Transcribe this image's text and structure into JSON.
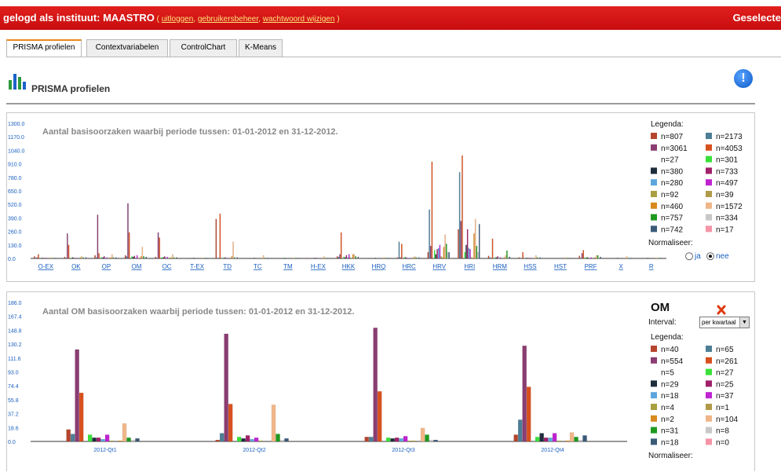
{
  "topbar": {
    "prefix": "gelogd als instituut: MAASTRO",
    "open_paren": " ( ",
    "link_logout": "uitloggen",
    "comma1": ", ",
    "link_users": "gebruikersbeheer",
    "comma2": ", ",
    "link_password": "wachtwoord wijzigen",
    "close_paren": " )",
    "right_text": "Geselecte",
    "color": "#d3151a"
  },
  "tabs": [
    "PRISMA profielen",
    "Contextvariabelen",
    "ControlChart",
    "K-Means"
  ],
  "header": {
    "title": "PRISMA profielen"
  },
  "chart_data": [
    {
      "type": "bar",
      "title": "Aantal basisoorzaken waarbij periode tussen: 01-01-2012 en 31-12-2012.",
      "categories": [
        "O-EX",
        "OK",
        "OP",
        "OM",
        "OC",
        "T-EX",
        "TD",
        "TC",
        "TM",
        "H-EX",
        "HKK",
        "HRQ",
        "HRC",
        "HRV",
        "HRI",
        "HRM",
        "HSS",
        "HST",
        "PRF",
        "X",
        "R"
      ],
      "yticks": [
        "0.0",
        "130.0",
        "260.0",
        "390.0",
        "520.0",
        "650.0",
        "780.0",
        "910.0",
        "1040.0",
        "1170.0",
        "1300.0"
      ],
      "ylim": [
        0,
        1300
      ],
      "legend_title": "Legenda:",
      "series": [
        {
          "label": "n=807",
          "color": "#b5452e",
          "values": [
            20,
            15,
            30,
            30,
            15,
            0,
            380,
            0,
            0,
            5,
            20,
            0,
            10,
            60,
            280,
            25,
            10,
            0,
            25,
            0,
            0
          ]
        },
        {
          "label": "n=2173",
          "color": "#4e7e95",
          "values": [
            5,
            5,
            10,
            20,
            5,
            0,
            5,
            0,
            0,
            0,
            15,
            5,
            160,
            470,
            830,
            10,
            5,
            0,
            5,
            0,
            0
          ]
        },
        {
          "label": "n=3061",
          "color": "#8a3d72",
          "values": [
            10,
            240,
            420,
            530,
            250,
            0,
            5,
            0,
            0,
            0,
            40,
            0,
            10,
            120,
            360,
            5,
            0,
            0,
            50,
            0,
            0
          ]
        },
        {
          "label": "n=4053",
          "color": "#d8501e",
          "values": [
            40,
            130,
            50,
            250,
            200,
            0,
            430,
            0,
            0,
            0,
            250,
            0,
            140,
            930,
            990,
            190,
            60,
            0,
            80,
            0,
            0
          ]
        },
        {
          "label": "n=27",
          "color": "#ffffff",
          "values": [
            0,
            0,
            0,
            0,
            0,
            0,
            0,
            0,
            0,
            0,
            0,
            0,
            0,
            0,
            0,
            0,
            0,
            0,
            0,
            0,
            0
          ]
        },
        {
          "label": "n=301",
          "color": "#39e039",
          "values": [
            0,
            5,
            10,
            20,
            10,
            0,
            5,
            0,
            5,
            0,
            15,
            0,
            10,
            80,
            60,
            10,
            0,
            0,
            10,
            0,
            0
          ]
        },
        {
          "label": "n=380",
          "color": "#1e2d3c",
          "values": [
            5,
            10,
            10,
            15,
            10,
            5,
            5,
            5,
            5,
            5,
            10,
            5,
            10,
            40,
            130,
            10,
            5,
            0,
            10,
            5,
            5
          ]
        },
        {
          "label": "n=733",
          "color": "#a0206a",
          "values": [
            5,
            5,
            20,
            25,
            20,
            0,
            10,
            0,
            0,
            5,
            30,
            0,
            5,
            90,
            280,
            20,
            5,
            0,
            5,
            0,
            0
          ]
        },
        {
          "label": "n=280",
          "color": "#5ca6dc",
          "values": [
            0,
            0,
            5,
            5,
            5,
            0,
            5,
            0,
            0,
            0,
            10,
            0,
            5,
            100,
            100,
            5,
            0,
            0,
            5,
            0,
            0
          ]
        },
        {
          "label": "n=497",
          "color": "#c023d0",
          "values": [
            5,
            5,
            10,
            30,
            15,
            0,
            5,
            0,
            0,
            0,
            40,
            0,
            5,
            130,
            90,
            10,
            5,
            0,
            10,
            0,
            0
          ]
        },
        {
          "label": "n=92",
          "color": "#a8a040",
          "values": [
            0,
            0,
            5,
            5,
            5,
            0,
            5,
            0,
            0,
            0,
            10,
            0,
            5,
            20,
            10,
            5,
            0,
            0,
            5,
            0,
            0
          ]
        },
        {
          "label": "n=39",
          "color": "#b09a48",
          "values": [
            0,
            0,
            0,
            5,
            0,
            0,
            0,
            0,
            0,
            0,
            5,
            0,
            0,
            10,
            5,
            0,
            0,
            0,
            0,
            0,
            0
          ]
        },
        {
          "label": "n=460",
          "color": "#d88a1e",
          "values": [
            5,
            10,
            10,
            20,
            10,
            5,
            20,
            5,
            5,
            5,
            40,
            5,
            10,
            110,
            240,
            10,
            5,
            5,
            10,
            5,
            5
          ]
        },
        {
          "label": "n=1572",
          "color": "#f0b688",
          "values": [
            10,
            20,
            40,
            110,
            40,
            5,
            160,
            30,
            5,
            20,
            40,
            10,
            20,
            230,
            380,
            30,
            30,
            10,
            30,
            20,
            5
          ]
        },
        {
          "label": "n=757",
          "color": "#1e9a1e",
          "values": [
            5,
            10,
            10,
            20,
            10,
            5,
            10,
            5,
            5,
            5,
            20,
            5,
            10,
            140,
            120,
            75,
            10,
            5,
            30,
            5,
            5
          ]
        },
        {
          "label": "n=334",
          "color": "#c8c8c8",
          "values": [
            0,
            5,
            5,
            10,
            5,
            0,
            5,
            0,
            0,
            0,
            10,
            0,
            5,
            60,
            60,
            10,
            5,
            0,
            5,
            0,
            0
          ]
        },
        {
          "label": "n=742",
          "color": "#3a5a78",
          "values": [
            5,
            10,
            10,
            15,
            10,
            5,
            10,
            5,
            5,
            5,
            15,
            5,
            10,
            60,
            330,
            15,
            10,
            5,
            15,
            5,
            5
          ]
        },
        {
          "label": "n=17",
          "color": "#f594a8",
          "values": [
            0,
            0,
            0,
            5,
            0,
            0,
            0,
            0,
            0,
            0,
            5,
            0,
            0,
            5,
            0,
            0,
            0,
            0,
            0,
            0,
            0
          ]
        }
      ],
      "normalize_label": "Normaliseer:",
      "radio_yes": "ja",
      "radio_no": "nee",
      "normalize_selected": "nee"
    },
    {
      "type": "bar",
      "title": "Aantal OM basisoorzaken waarbij periode tussen: 01-01-2012 en 31-12-2012.",
      "categories": [
        "2012-Qt1",
        "2012-Qt2",
        "2012-Qt3",
        "2012-Qt4"
      ],
      "yticks": [
        "0.0",
        "18.6",
        "37.2",
        "55.8",
        "74.4",
        "93.0",
        "111.6",
        "130.2",
        "148.8",
        "167.4",
        "186.0"
      ],
      "ylim": [
        0,
        186
      ],
      "om_heading": "OM",
      "interval_label": "Interval:",
      "interval_value": "per kwartaal",
      "legend_title": "Legenda:",
      "series": [
        {
          "label": "n=40",
          "color": "#b5452e",
          "values": [
            16,
            2,
            6,
            9
          ]
        },
        {
          "label": "n=65",
          "color": "#4e7e95",
          "values": [
            10,
            11,
            6,
            29
          ]
        },
        {
          "label": "n=554",
          "color": "#8a3d72",
          "values": [
            123,
            144,
            152,
            128
          ]
        },
        {
          "label": "n=261",
          "color": "#d8501e",
          "values": [
            65,
            50,
            67,
            73
          ]
        },
        {
          "label": "n=5",
          "color": "#ffffff",
          "values": [
            0,
            0,
            0,
            0
          ]
        },
        {
          "label": "n=27",
          "color": "#39e039",
          "values": [
            9,
            6,
            5,
            6
          ]
        },
        {
          "label": "n=29",
          "color": "#1e2d3c",
          "values": [
            5,
            4,
            4,
            11
          ]
        },
        {
          "label": "n=25",
          "color": "#a0206a",
          "values": [
            5,
            8,
            5,
            5
          ]
        },
        {
          "label": "n=18",
          "color": "#5ca6dc",
          "values": [
            3,
            3,
            4,
            5
          ]
        },
        {
          "label": "n=37",
          "color": "#c023d0",
          "values": [
            9,
            5,
            7,
            11
          ]
        },
        {
          "label": "n=4",
          "color": "#a8a040",
          "values": [
            1,
            1,
            1,
            1
          ]
        },
        {
          "label": "n=1",
          "color": "#b09a48",
          "values": [
            0,
            0,
            1,
            0
          ]
        },
        {
          "label": "n=2",
          "color": "#d88a1e",
          "values": [
            1,
            0,
            0,
            1
          ]
        },
        {
          "label": "n=104",
          "color": "#f0b688",
          "values": [
            24,
            49,
            18,
            12
          ]
        },
        {
          "label": "n=31",
          "color": "#1e9a1e",
          "values": [
            5,
            10,
            9,
            6
          ]
        },
        {
          "label": "n=8",
          "color": "#c8c8c8",
          "values": [
            2,
            2,
            2,
            2
          ]
        },
        {
          "label": "n=18",
          "color": "#3a5a78",
          "values": [
            4,
            4,
            2,
            8
          ]
        },
        {
          "label": "n=0",
          "color": "#f594a8",
          "values": [
            0,
            0,
            0,
            0
          ]
        }
      ],
      "normalize_label": "Normaliseer:"
    }
  ]
}
